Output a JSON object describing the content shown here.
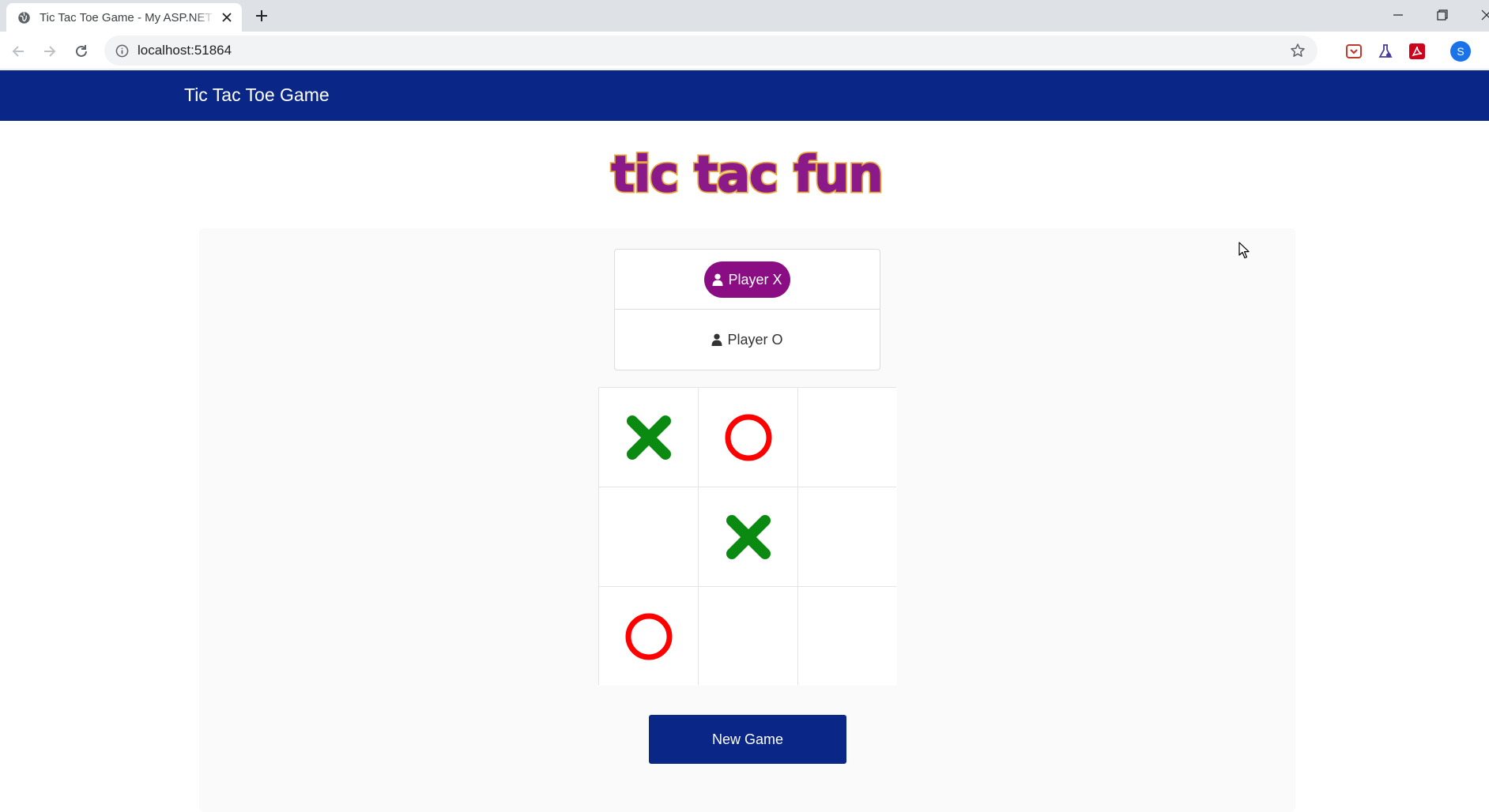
{
  "browser": {
    "tab_title": "Tic Tac Toe Game - My ASP.NET Application",
    "url": "localhost:51864",
    "profile_initial": "S"
  },
  "navbar": {
    "brand": "Tic Tac Toe Game"
  },
  "logo": {
    "text": "tic tac fun",
    "fill_color": "#8a1a8a",
    "outline_color": "#e6a83a"
  },
  "players": {
    "x_label": "Player X",
    "o_label": "Player O",
    "active": "X",
    "active_color": "#8a0d84"
  },
  "board": {
    "cells": [
      "X",
      "O",
      "",
      "",
      "X",
      "",
      "O",
      "",
      ""
    ],
    "x_color": "#0a8a10",
    "o_color": "#ff0000"
  },
  "actions": {
    "new_game_label": "New Game"
  },
  "colors": {
    "navbar": "#0a2686",
    "button": "#0a2686"
  }
}
